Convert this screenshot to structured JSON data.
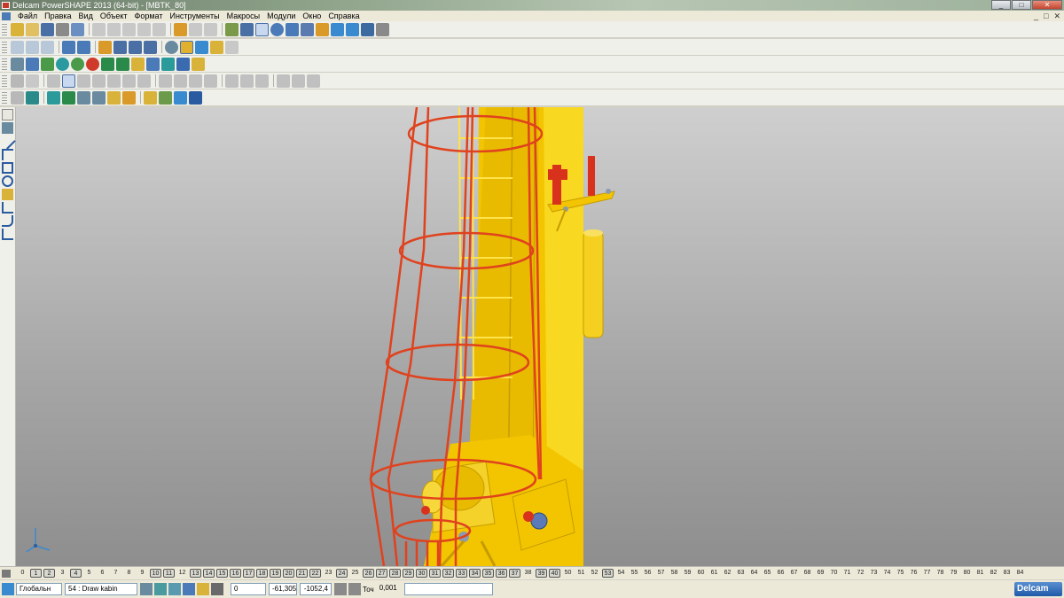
{
  "window": {
    "title": "Delcam PowerSHAPE 2013 (64-bit) - [MBTK_80]",
    "buttons": [
      "_",
      "□",
      "✕"
    ]
  },
  "menu": {
    "items": [
      "Файл",
      "Правка",
      "Вид",
      "Объект",
      "Формат",
      "Инструменты",
      "Макросы",
      "Модули",
      "Окно",
      "Справка"
    ],
    "mdi_buttons": [
      "_",
      "□",
      "✕"
    ]
  },
  "levels": {
    "numbers": [
      "0",
      "1",
      "2",
      "3",
      "4",
      "5",
      "6",
      "7",
      "8",
      "9",
      "10",
      "11",
      "12",
      "13",
      "14",
      "15",
      "16",
      "17",
      "18",
      "19",
      "20",
      "21",
      "22",
      "23",
      "24",
      "25",
      "26",
      "27",
      "28",
      "29",
      "30",
      "31",
      "32",
      "33",
      "34",
      "35",
      "36",
      "37",
      "38",
      "39",
      "40",
      "50",
      "51",
      "52",
      "53",
      "54",
      "55",
      "56",
      "57",
      "58",
      "59",
      "60",
      "61",
      "62",
      "63",
      "64",
      "65",
      "66",
      "67",
      "68",
      "69",
      "70",
      "71",
      "72",
      "73",
      "74",
      "75",
      "76",
      "77",
      "78",
      "79",
      "80",
      "81",
      "82",
      "83",
      "84"
    ],
    "active": [
      "1",
      "2",
      "4",
      "10",
      "11",
      "13",
      "14",
      "15",
      "16",
      "17",
      "18",
      "19",
      "20",
      "21",
      "22",
      "24",
      "26",
      "27",
      "28",
      "29",
      "30",
      "31",
      "32",
      "33",
      "34",
      "35",
      "36",
      "37",
      "39",
      "40",
      "53"
    ]
  },
  "status": {
    "workplane": "Глобальн",
    "level_number": "54",
    "level_name": "Draw kabin",
    "x_value": "0",
    "y_value": "-61,305",
    "z_value": "-1052,4",
    "tolerance_label": "Точ",
    "tolerance_value": "0,001",
    "brand": "Delcam"
  },
  "icons": {
    "toolbar_row1": [
      "new-icon",
      "open-icon",
      "save-icon",
      "print-icon",
      "cut-icon",
      "copy-icon",
      "paste-icon",
      "undo-icon",
      "redo-icon",
      "select-icon",
      "rotate-icon",
      "zoom-icon"
    ],
    "left_toolbar": [
      "pointer-icon",
      "line-icon",
      "polyline-icon",
      "rectangle-icon",
      "circle-icon",
      "solid-icon",
      "curve-icon",
      "dimension-icon"
    ]
  },
  "colors": {
    "model_yellow": "#f5cc00",
    "cage_red": "#e0421e",
    "background_top": "#cfcfcf",
    "background_bottom": "#8e8e8e"
  }
}
